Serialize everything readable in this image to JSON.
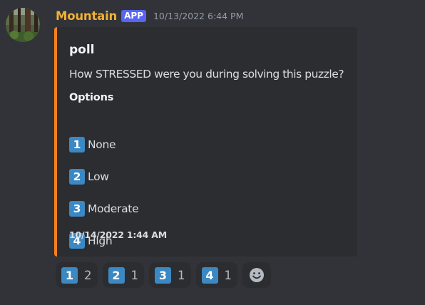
{
  "message": {
    "author": "Mountain",
    "tag": "APP",
    "timestamp": "10/13/2022 6:44 PM",
    "avatar_icon": "forest-avatar"
  },
  "embed": {
    "accent_color": "#f4811e",
    "title": "poll",
    "description": "How STRESSED were you during solving this puzzle?",
    "field_name": "Options",
    "options": [
      {
        "number": "1",
        "label": "None"
      },
      {
        "number": "2",
        "label": "Low"
      },
      {
        "number": "3",
        "label": "Moderate"
      },
      {
        "number": "4",
        "label": "High"
      }
    ],
    "footer_timestamp": "10/14/2022 1:44 AM"
  },
  "reactions": [
    {
      "emoji": "1",
      "count": "2"
    },
    {
      "emoji": "2",
      "count": "1"
    },
    {
      "emoji": "3",
      "count": "1"
    },
    {
      "emoji": "4",
      "count": "1"
    }
  ],
  "add_reaction_icon": "smiley-add-reaction-icon",
  "colors": {
    "background": "#313338",
    "embed_background": "#2b2d31",
    "username": "#f0b232",
    "app_badge": "#5865f2",
    "keycap": "#3b88c3"
  }
}
